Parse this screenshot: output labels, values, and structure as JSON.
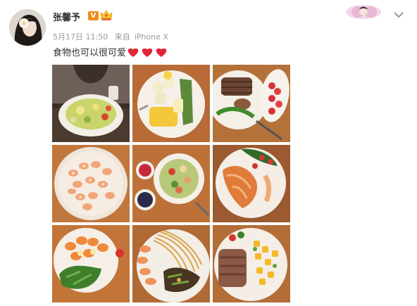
{
  "post": {
    "username": "张馨予",
    "vip_badge": "V",
    "date": "5月17日 11:50",
    "source_prefix": "来自",
    "source": "iPhone X",
    "text": "食物也可以很可爱",
    "emoji": "❤❤❤"
  },
  "icons": {
    "avatar": "avatar",
    "crown": "crown-icon",
    "chevron": "chevron-down-icon"
  },
  "photos": [
    {
      "name": "salad-with-person"
    },
    {
      "name": "vegetables-plate"
    },
    {
      "name": "steak-strawberries"
    },
    {
      "name": "shrimp-plate"
    },
    {
      "name": "salad-berries-bowls"
    },
    {
      "name": "grilled-fish-salad"
    },
    {
      "name": "shrimp-greens"
    },
    {
      "name": "noodles-shrimp"
    },
    {
      "name": "steak-mango-salad"
    }
  ],
  "colors": {
    "accent": "#eb7350",
    "heart": "#e1263a",
    "vip": "#f28c1e"
  }
}
